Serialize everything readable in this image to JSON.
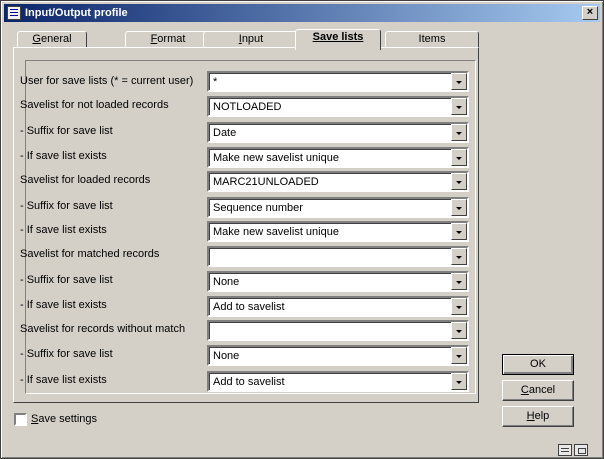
{
  "window": {
    "title": "Input/Output profile"
  },
  "tabs": [
    {
      "first": "G",
      "rest": "eneral"
    },
    {
      "first": "F",
      "rest": "ormat"
    },
    {
      "first": "I",
      "rest": "nput"
    },
    {
      "first": "S",
      "rest": "ave lists"
    },
    {
      "first": "",
      "rest": "Items"
    }
  ],
  "active_tab": "Save lists",
  "fields": [
    {
      "label": "User for save lists (* = current user)",
      "value": "*"
    },
    {
      "label": "Savelist for not loaded records",
      "value": "NOTLOADED"
    },
    {
      "label": "- Suffix for save list",
      "value": "Date"
    },
    {
      "label": "- If save list exists",
      "value": "Make new savelist unique"
    },
    {
      "label": "Savelist for loaded records",
      "value": "MARC21UNLOADED"
    },
    {
      "label": "- Suffix for save list",
      "value": "Sequence number"
    },
    {
      "label": "- If save list exists",
      "value": "Make new savelist unique"
    },
    {
      "label": "Savelist for matched records",
      "value": ""
    },
    {
      "label": "- Suffix for save list",
      "value": "None"
    },
    {
      "label": "- If save list exists",
      "value": "Add to savelist"
    },
    {
      "label": "Savelist for records without match",
      "value": ""
    },
    {
      "label": "- Suffix for save list",
      "value": "None"
    },
    {
      "label": "- If save list exists",
      "value": "Add to savelist"
    }
  ],
  "buttons": {
    "ok": "OK",
    "cancel_first": "C",
    "cancel_rest": "ancel",
    "help_first": "H",
    "help_rest": "elp"
  },
  "save_settings": {
    "first": "S",
    "rest": "ave settings",
    "checked": false
  },
  "icons": {
    "app": "profile-app-icon",
    "close": "close-icon",
    "keyboard": "keyboard-icon",
    "resize": "resize-icon"
  }
}
